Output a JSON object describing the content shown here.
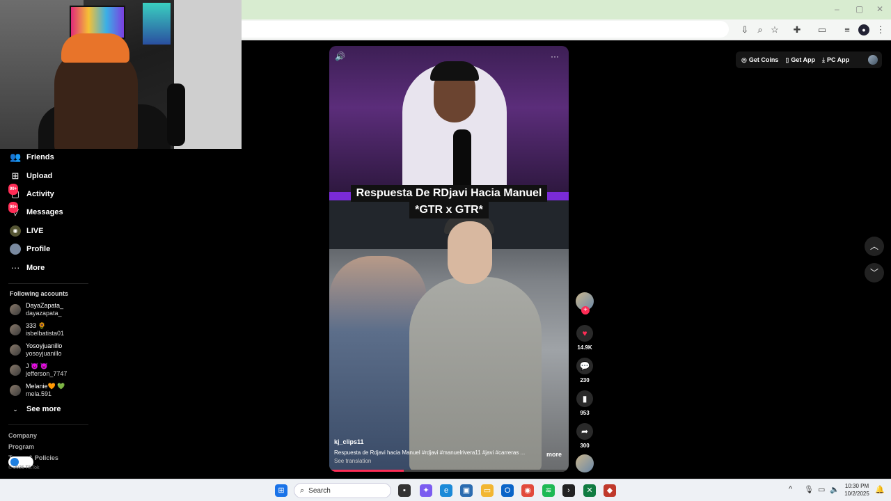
{
  "browser": {
    "window_controls": [
      "–",
      "▢",
      "✕"
    ],
    "toolbar_icons": [
      "install-icon",
      "zoom-icon",
      "star-icon",
      "extensions-icon",
      "cast-icon",
      "media-icon",
      "profile-icon",
      "menu-icon"
    ]
  },
  "sidebar": {
    "nav": [
      {
        "label": "Friends",
        "icon": "friends-icon"
      },
      {
        "label": "Upload",
        "icon": "upload-icon"
      },
      {
        "label": "Activity",
        "icon": "activity-icon",
        "badge": "99+"
      },
      {
        "label": "Messages",
        "icon": "messages-icon",
        "badge": "99+"
      },
      {
        "label": "LIVE",
        "icon": "live-icon"
      },
      {
        "label": "Profile",
        "icon": "profile-icon"
      },
      {
        "label": "More",
        "icon": "more-icon"
      }
    ],
    "following_title": "Following accounts",
    "following": [
      {
        "name": "DayaZapata_",
        "user": "dayazapata_"
      },
      {
        "name": "333 🌻",
        "user": "isbelbatista01"
      },
      {
        "name": "Yosoyjuanillo",
        "user": "yosoyjuanillo"
      },
      {
        "name": "J 👿 👿",
        "user": "jefferson_7747"
      },
      {
        "name": "Melanie🧡 💚",
        "user": "mela.591"
      }
    ],
    "see_more": "See more",
    "footer": [
      "Company",
      "Program",
      "Terms & Policies"
    ],
    "copyright": "© 2025 TikTok"
  },
  "top_buttons": [
    {
      "label": "Get Coins",
      "icon": "coin-icon"
    },
    {
      "label": "Get App",
      "icon": "phone-icon"
    },
    {
      "label": "PC App",
      "icon": "download-icon"
    }
  ],
  "video": {
    "title_line1": "Respuesta De RDjavi Hacia Manuel",
    "title_line2": "*GTR x GTR*",
    "author": "kj_clips11",
    "caption": "Respuesta de Rdjavi hacia Manuel  #rdjavi  #manuelrivera11 #javi #carreras ...",
    "more": "more",
    "see_translation": "See translation",
    "progress": 0.31
  },
  "actions": {
    "likes": "14.9K",
    "comments": "230",
    "saves": "953",
    "shares": "300"
  },
  "taskbar": {
    "search_placeholder": "Search",
    "time": "10:30 PM",
    "date": "10/2/2025"
  },
  "colors": {
    "accent": "#fe2c55",
    "titlebar": "#d8ecd0",
    "strip": "#7a2bd8"
  }
}
